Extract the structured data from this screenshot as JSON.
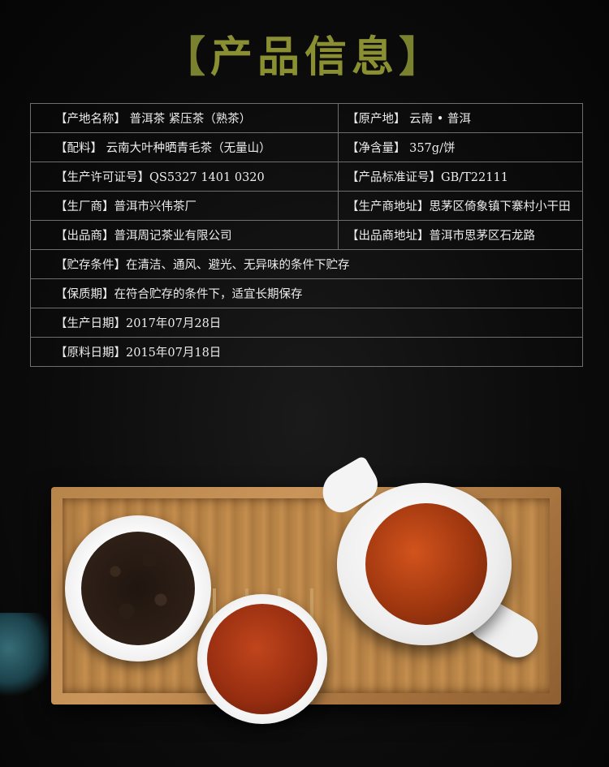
{
  "page": {
    "title_left_bracket": "【",
    "title_text": "产品信息",
    "title_right_bracket": "】"
  },
  "info_rows": [
    {
      "left": "【产地名称】 普洱茶 紧压茶（熟茶）",
      "right": "【原产地】 云南 • 普洱"
    },
    {
      "left": "【配料】  云南大叶种晒青毛茶（无量山）",
      "right": "【净含量】  357g/饼"
    },
    {
      "left": "【生产许可证号】QS5327 1401 0320",
      "right": "【产品标准证号】GB/T22111"
    },
    {
      "left": "【生厂商】普洱市兴伟茶厂",
      "right": "【生产商地址】思茅区倚象镇下寨村小干田"
    },
    {
      "left": "【出品商】普洱周记茶业有限公司",
      "right": "【出品商地址】普洱市思茅区石龙路"
    },
    {
      "full": "【贮存条件】在清洁、通风、避光、无异味的条件下贮存"
    },
    {
      "full": "【保质期】在符合贮存的条件下，适宜长期保存"
    },
    {
      "full": "【生产日期】2017年07月28日"
    },
    {
      "full": "【原料日期】2015年07月18日"
    }
  ],
  "colors": {
    "title": "#8a8f32",
    "border": "#6e6e6e",
    "background": "#0c0c0c"
  }
}
